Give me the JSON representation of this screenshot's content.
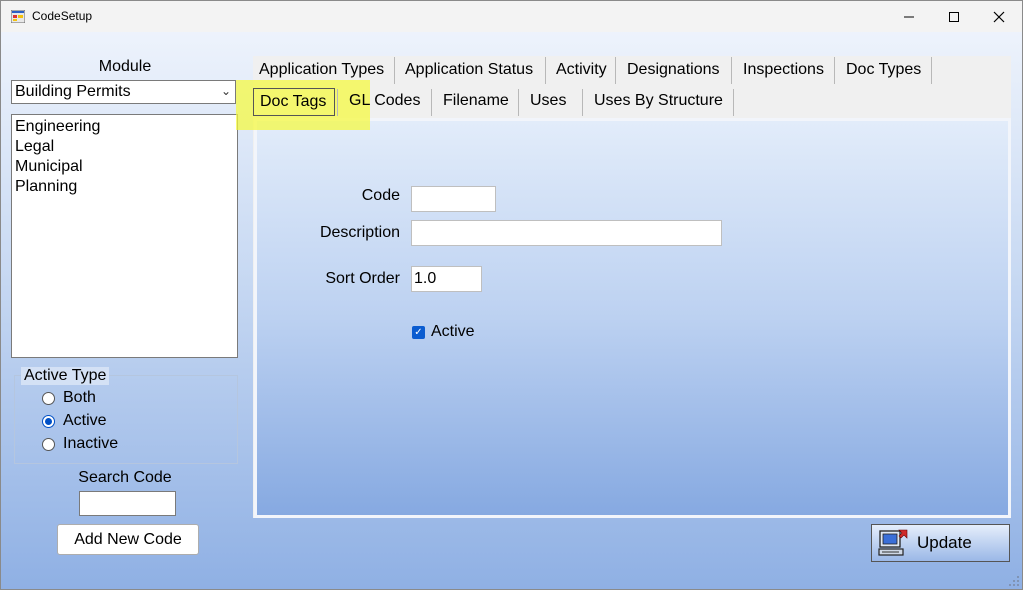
{
  "window": {
    "title": "CodeSetup"
  },
  "left": {
    "module_label": "Module",
    "module_selected": "Building Permits",
    "module_list": [
      "Engineering",
      "Legal",
      "Municipal",
      "Planning"
    ],
    "active_type_label": "Active Type",
    "active_type_options": [
      {
        "label": "Both",
        "selected": false
      },
      {
        "label": "Active",
        "selected": true
      },
      {
        "label": "Inactive",
        "selected": false
      }
    ],
    "search_label": "Search Code",
    "search_value": "",
    "add_button": "Add New Code"
  },
  "tabs": {
    "row1": [
      "Application Types",
      "Application Status",
      "Activity",
      "Designations",
      "Inspections",
      "Doc Types"
    ],
    "row2": [
      "Doc Tags",
      "GL Codes",
      "Filename",
      "Uses",
      "Uses By Structure"
    ],
    "selected": "Doc Tags"
  },
  "form": {
    "code_label": "Code",
    "code_value": "",
    "description_label": "Description",
    "description_value": "",
    "sort_order_label": "Sort Order",
    "sort_order_value": "1.0",
    "active_label": "Active",
    "active_checked": true
  },
  "update_button": "Update",
  "icons": [
    "app-icon",
    "minimize-icon",
    "maximize-icon",
    "close-icon",
    "chevron-down-icon",
    "update-icon",
    "resize-grip-icon"
  ]
}
